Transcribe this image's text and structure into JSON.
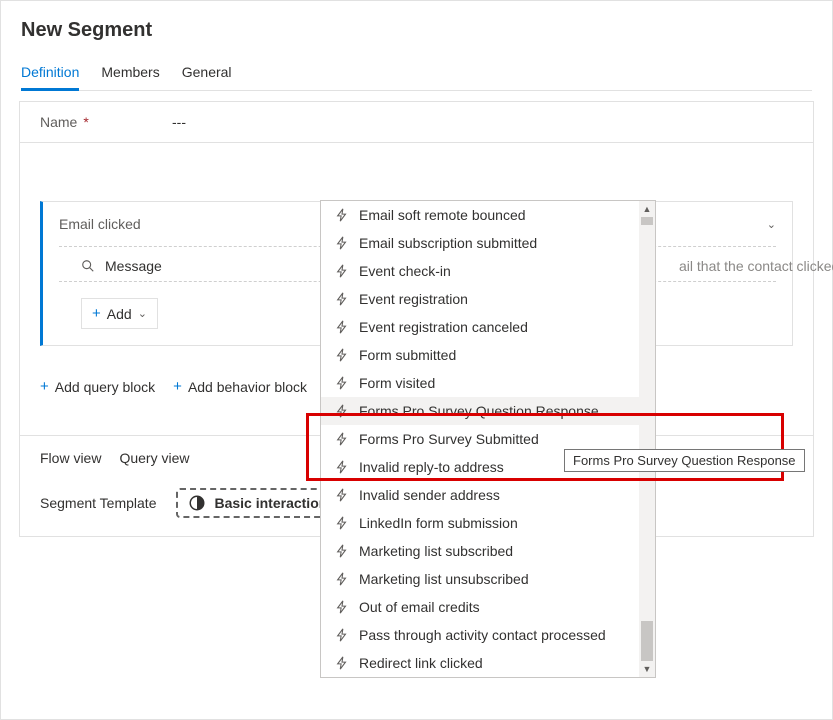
{
  "header": {
    "title": "New Segment",
    "tabs": [
      "Definition",
      "Members",
      "General"
    ],
    "activeTab": 0
  },
  "nameField": {
    "label": "Name",
    "required": "*",
    "value": "---"
  },
  "block": {
    "title": "Email clicked",
    "filterLabel": "Message",
    "hint": "ail that the contact clicked on",
    "addLabel": "Add"
  },
  "actionBtns": {
    "addQuery": "Add query block",
    "addBehavior": "Add behavior block"
  },
  "views": {
    "flow": "Flow view",
    "query": "Query view",
    "tmplLabel": "Segment Template",
    "tmplChip": "Basic interaction"
  },
  "dropdown": {
    "items": [
      "Email soft remote bounced",
      "Email subscription submitted",
      "Event check-in",
      "Event registration",
      "Event registration canceled",
      "Form submitted",
      "Form visited",
      "Forms Pro Survey Question Response",
      "Forms Pro Survey Submitted",
      "Invalid reply-to address",
      "Invalid sender address",
      "LinkedIn form submission",
      "Marketing list subscribed",
      "Marketing list unsubscribed",
      "Out of email credits",
      "Pass through activity contact processed",
      "Redirect link clicked"
    ],
    "hoveredIndex": 7
  },
  "tooltip": "Forms Pro Survey Question Response"
}
